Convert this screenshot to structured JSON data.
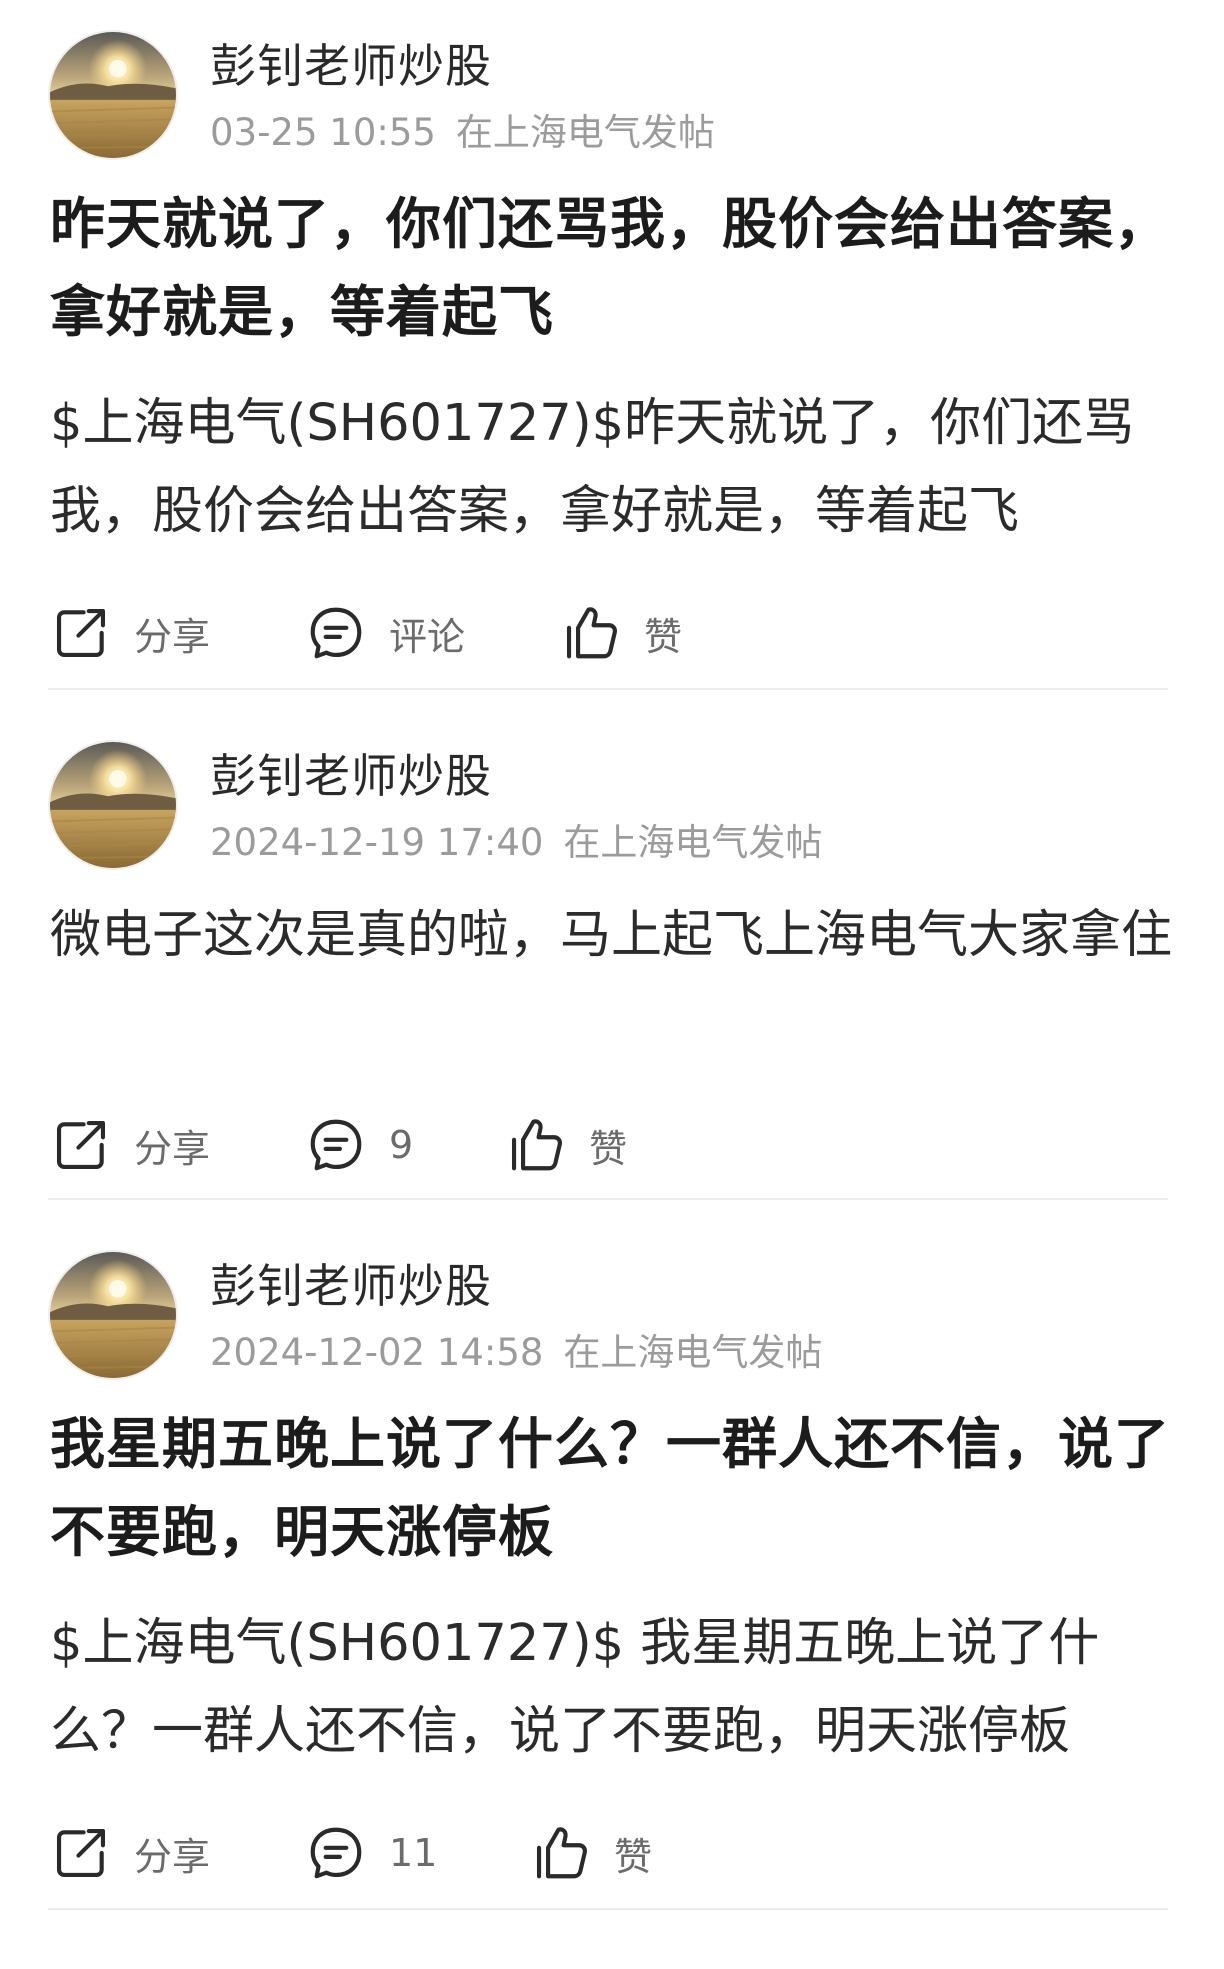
{
  "posts": [
    {
      "author": "彭钊老师炒股",
      "time": "03-25 10:55",
      "location": "在上海电气发帖",
      "title": "昨天就说了，你们还骂我，股价会给出答案，拿好就是，等着起飞",
      "body": "$上海电气(SH601727)$昨天就说了，你们还骂我，股价会给出答案，拿好就是，等着起飞",
      "share_label": "分享",
      "comment_label": "评论",
      "like_label": "赞"
    },
    {
      "author": "彭钊老师炒股",
      "time": "2024-12-19 17:40",
      "location": "在上海电气发帖",
      "title": "",
      "body": "微电子这次是真的啦，马上起飞上海电气大家拿住",
      "share_label": "分享",
      "comment_label": "9",
      "like_label": "赞"
    },
    {
      "author": "彭钊老师炒股",
      "time": "2024-12-02 14:58",
      "location": "在上海电气发帖",
      "title": "我星期五晚上说了什么？一群人还不信，说了不要跑，明天涨停板",
      "body": "$上海电气(SH601727)$ 我星期五晚上说了什么？一群人还不信，说了不要跑，明天涨停板",
      "share_label": "分享",
      "comment_label": "11",
      "like_label": "赞"
    }
  ],
  "icons": {
    "share": "share-icon",
    "comment": "comment-icon",
    "like": "thumbs-up-icon"
  },
  "colors": {
    "text": "#1f1f1f",
    "meta": "#9b9b9b",
    "divider": "#ececec"
  }
}
